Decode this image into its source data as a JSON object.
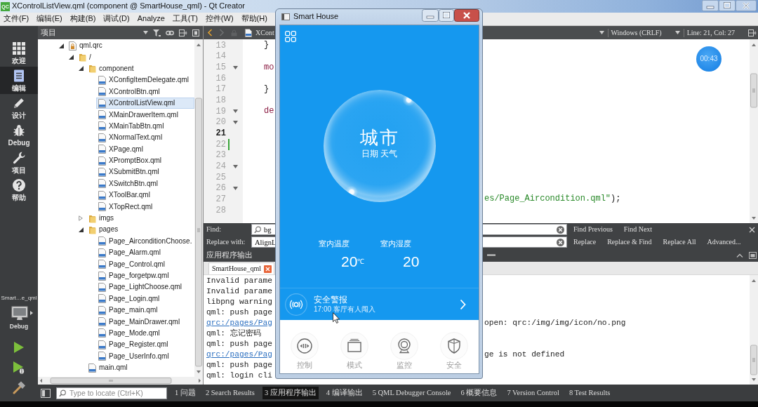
{
  "window": {
    "logo": "QC",
    "title": "XControlListView.qml (component @ SmartHouse_qml) - Qt Creator"
  },
  "menu": [
    "文件(F)",
    "编辑(E)",
    "构建(B)",
    "调试(D)",
    "Analyze",
    "工具(T)",
    "控件(W)",
    "帮助(H)"
  ],
  "mode_bar": {
    "items": [
      {
        "label": "欢迎",
        "kind": "welcome",
        "selected": false
      },
      {
        "label": "编辑",
        "kind": "edit",
        "selected": true
      },
      {
        "label": "设计",
        "kind": "design",
        "selected": false
      },
      {
        "label": "Debug",
        "kind": "debug",
        "selected": false
      },
      {
        "label": "项目",
        "kind": "projects",
        "selected": false
      },
      {
        "label": "帮助",
        "kind": "help",
        "selected": false
      }
    ],
    "target": {
      "project": "Smart…e_qml",
      "build": "Debug"
    }
  },
  "project_panel": {
    "title": "项目",
    "tree": [
      {
        "label": "qml.qrc",
        "kind": "resource",
        "expanded": true,
        "selected": false,
        "children": [
          {
            "label": "/",
            "kind": "folder",
            "expanded": true,
            "selected": false,
            "children": [
              {
                "label": "component",
                "kind": "folder",
                "expanded": true,
                "selected": false,
                "children": [
                  {
                    "label": "XConfigItemDelegate.qml",
                    "kind": "file",
                    "selected": false
                  },
                  {
                    "label": "XControlBtn.qml",
                    "kind": "file",
                    "selected": false
                  },
                  {
                    "label": "XControlListView.qml",
                    "kind": "file",
                    "selected": true
                  },
                  {
                    "label": "XMainDrawerItem.qml",
                    "kind": "file",
                    "selected": false
                  },
                  {
                    "label": "XMainTabBtn.qml",
                    "kind": "file",
                    "selected": false
                  },
                  {
                    "label": "XNormalText.qml",
                    "kind": "file",
                    "selected": false
                  },
                  {
                    "label": "XPage.qml",
                    "kind": "file",
                    "selected": false
                  },
                  {
                    "label": "XPromptBox.qml",
                    "kind": "file",
                    "selected": false
                  },
                  {
                    "label": "XSubmitBtn.qml",
                    "kind": "file",
                    "selected": false
                  },
                  {
                    "label": "XSwitchBtn.qml",
                    "kind": "file",
                    "selected": false
                  },
                  {
                    "label": "XToolBar.qml",
                    "kind": "file",
                    "selected": false
                  },
                  {
                    "label": "XTopRect.qml",
                    "kind": "file",
                    "selected": false
                  }
                ]
              },
              {
                "label": "imgs",
                "kind": "folder",
                "expanded": false,
                "selected": false
              },
              {
                "label": "pages",
                "kind": "folder",
                "expanded": true,
                "selected": false,
                "children": [
                  {
                    "label": "Page_AirconditionChoose.",
                    "kind": "file",
                    "selected": false
                  },
                  {
                    "label": "Page_Alarm.qml",
                    "kind": "file",
                    "selected": false
                  },
                  {
                    "label": "Page_Control.qml",
                    "kind": "file",
                    "selected": false
                  },
                  {
                    "label": "Page_forgetpw.qml",
                    "kind": "file",
                    "selected": false
                  },
                  {
                    "label": "Page_LightChoose.qml",
                    "kind": "file",
                    "selected": false
                  },
                  {
                    "label": "Page_Login.qml",
                    "kind": "file",
                    "selected": false
                  },
                  {
                    "label": "Page_main.qml",
                    "kind": "file",
                    "selected": false
                  },
                  {
                    "label": "Page_MainDrawer.qml",
                    "kind": "file",
                    "selected": false
                  },
                  {
                    "label": "Page_Mode.qml",
                    "kind": "file",
                    "selected": false
                  },
                  {
                    "label": "Page_Register.qml",
                    "kind": "file",
                    "selected": false
                  },
                  {
                    "label": "Page_UserInfo.qml",
                    "kind": "file",
                    "selected": false
                  }
                ]
              },
              {
                "label": "main.qml",
                "kind": "file",
                "selected": false
              }
            ]
          }
        ]
      }
    ]
  },
  "editor": {
    "file": "XCont",
    "line_ending": "Windows (CRLF)",
    "cursor": "Line: 21, Col: 27",
    "lines": [
      {
        "number": "13",
        "code": "}",
        "kind": "plain",
        "foldable": false,
        "current": false,
        "changed": false
      },
      {
        "number": "14",
        "foldable": false,
        "current": false,
        "changed": false
      },
      {
        "number": "15",
        "code": "mo",
        "kind": "keyword",
        "foldable": true,
        "current": false,
        "changed": false
      },
      {
        "number": "16",
        "foldable": false,
        "current": false,
        "changed": false
      },
      {
        "number": "17",
        "code": "}",
        "kind": "plain",
        "foldable": false,
        "current": false,
        "changed": false
      },
      {
        "number": "18",
        "foldable": false,
        "current": false,
        "changed": false
      },
      {
        "number": "19",
        "code": "de",
        "kind": "keyword",
        "foldable": true,
        "current": false,
        "changed": false
      },
      {
        "number": "20",
        "foldable": true,
        "current": false,
        "changed": false
      },
      {
        "number": "21",
        "foldable": false,
        "current": true,
        "changed": false
      },
      {
        "number": "22",
        "foldable": false,
        "current": false,
        "changed": true
      },
      {
        "number": "23",
        "foldable": false,
        "current": false,
        "changed": false
      },
      {
        "number": "24",
        "foldable": true,
        "current": false,
        "changed": false
      },
      {
        "number": "25",
        "foldable": false,
        "current": false,
        "changed": false
      },
      {
        "number": "26",
        "foldable": true,
        "current": false,
        "changed": false
      },
      {
        "number": "27",
        "tail": [
          {
            "text": "es/Page_Aircondition.qml\"",
            "kind": "string"
          },
          {
            "text": ");",
            "kind": "plain"
          }
        ],
        "foldable": false,
        "current": false,
        "changed": false
      },
      {
        "number": "28",
        "foldable": false,
        "current": false,
        "changed": false
      }
    ]
  },
  "recording_timer": "00:43",
  "find_bar": {
    "find_label": "Find:",
    "find_value": "bg",
    "replace_label": "Replace with:",
    "replace_value": "AlignL",
    "find_actions": [
      "Find Previous",
      "Find Next"
    ],
    "replace_actions": [
      "Replace",
      "Replace & Find",
      "Replace All",
      "Advanced..."
    ]
  },
  "output": {
    "title": "应用程序输出",
    "tabs": [
      {
        "label": "SmartHouse_qml",
        "selected": true
      }
    ],
    "lines": [
      {
        "text": "Invalid parame",
        "kind": "plain"
      },
      {
        "text": "Invalid parame",
        "kind": "plain"
      },
      {
        "text": "libpng warning",
        "kind": "plain"
      },
      {
        "text": "qml: push page",
        "kind": "plain"
      },
      {
        "text": "qrc:/pages/Pag",
        "kind": "link",
        "tail": "open: qrc:/img/img/icon/no.png"
      },
      {
        "text": "qml: 忘记密码",
        "kind": "plain"
      },
      {
        "text": "qml: push page",
        "kind": "plain"
      },
      {
        "text": "qrc:/pages/Pag",
        "kind": "link",
        "tail": "ge is not defined"
      },
      {
        "text": "qml: push page",
        "kind": "plain"
      },
      {
        "text": "qml: login cli",
        "kind": "plain"
      }
    ]
  },
  "status_bar": {
    "locate_placeholder": "Type to locate (Ctrl+K)",
    "panes": [
      {
        "label": "1 问题",
        "selected": false
      },
      {
        "label": "2 Search Results",
        "selected": false
      },
      {
        "label": "3 应用程序输出",
        "selected": true
      },
      {
        "label": "4 编译输出",
        "selected": false
      },
      {
        "label": "5 QML Debugger Console",
        "selected": false
      },
      {
        "label": "6 概要信息",
        "selected": false
      },
      {
        "label": "7 Version Control",
        "selected": false
      },
      {
        "label": "8 Test Results",
        "selected": false
      }
    ]
  },
  "app_window": {
    "title": "Smart House",
    "city": "城市",
    "date_weather": "日期 天气",
    "readings": [
      {
        "label": "室内温度",
        "value": "20",
        "unit": "℃"
      },
      {
        "label": "室内湿度",
        "value": "20"
      }
    ],
    "alert": {
      "title": "安全警报",
      "detail": "17:00 客厅有人闯入"
    },
    "nav": [
      {
        "label": "控制",
        "kind": "control"
      },
      {
        "label": "模式",
        "kind": "mode"
      },
      {
        "label": "监控",
        "kind": "monitor"
      },
      {
        "label": "安全",
        "kind": "security"
      }
    ]
  }
}
